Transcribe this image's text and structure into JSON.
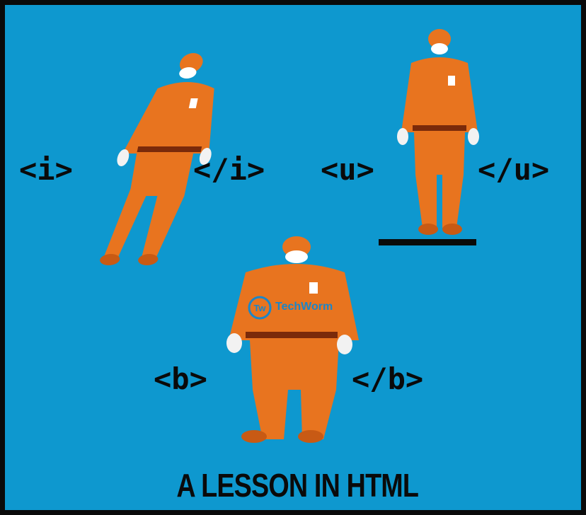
{
  "tags": {
    "i_open": "<i>",
    "i_close": "</i>",
    "u_open": "<u>",
    "u_close": "</u>",
    "b_open": "<b>",
    "b_close": "</b>"
  },
  "caption": "A LESSON IN HTML",
  "watermark": {
    "logo_text": "Tw",
    "brand": "TechWorm"
  },
  "colors": {
    "background": "#0e98cf",
    "suit": "#e8741f",
    "text": "#0a0a0a"
  }
}
